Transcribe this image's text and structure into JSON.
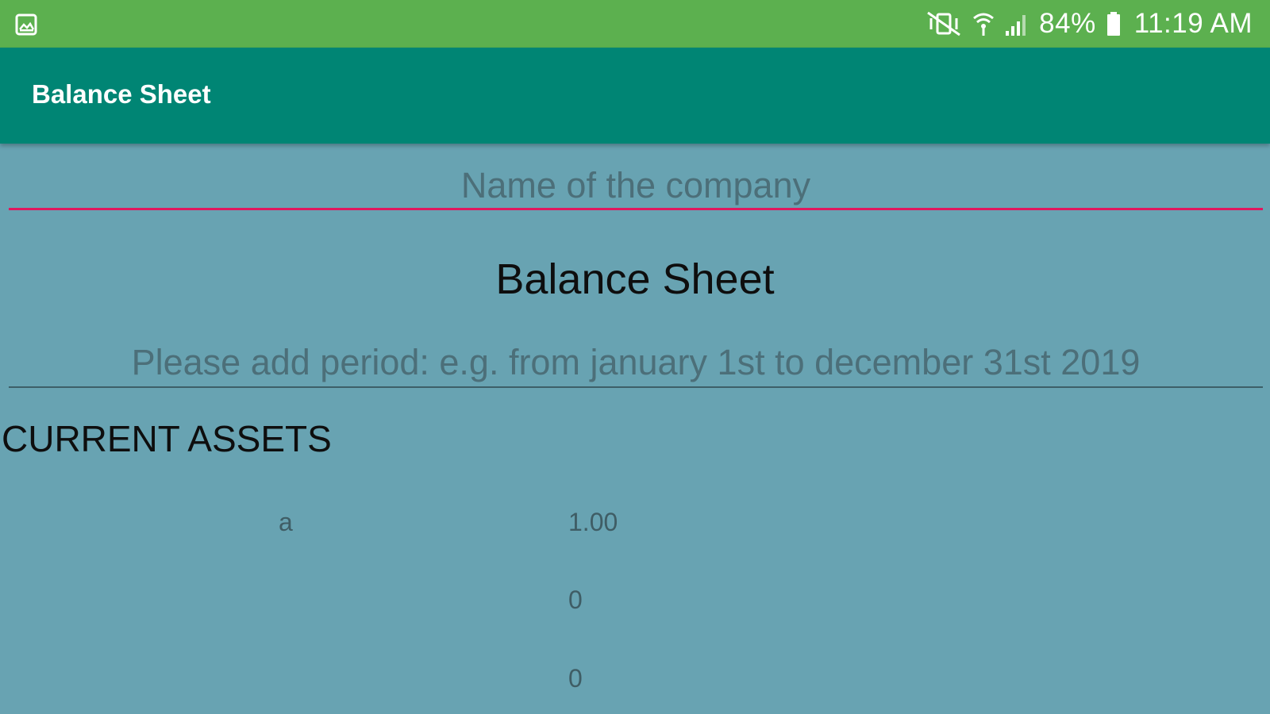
{
  "status_bar": {
    "left_icon": "image-notification-icon",
    "icons": [
      "vibrate-icon",
      "wifi-icon",
      "signal-icon",
      "battery-icon"
    ],
    "battery": "84%",
    "time": "11:19 AM",
    "color": "#5cb04f"
  },
  "app_bar": {
    "title": "Balance Sheet",
    "color": "#008574"
  },
  "form": {
    "company_placeholder": "Name of the company",
    "company_value": "",
    "heading": "Balance Sheet",
    "period_placeholder": "Please add period: e.g. from january 1st to december 31st 2019",
    "period_value": "",
    "accent_color": "#e0175e"
  },
  "current_assets": {
    "title": "CURRENT ASSETS",
    "rows": [
      {
        "name": "a",
        "value": "1.00"
      },
      {
        "name": "",
        "value": "0"
      },
      {
        "name": "",
        "value": "0"
      }
    ]
  },
  "background_color": "#68a3b2"
}
